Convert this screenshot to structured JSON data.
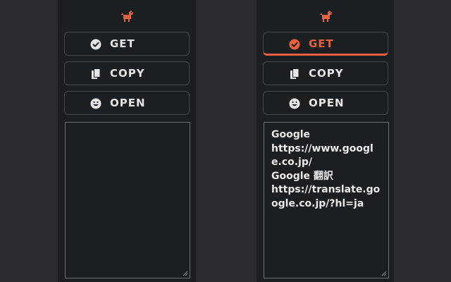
{
  "colors": {
    "accent": "#e9603e",
    "panel_bg": "#1c1f21",
    "page_bg": "#2b2c30",
    "text": "#e6e6e6",
    "border": "#43484c"
  },
  "left_panel": {
    "logo_icon": "dog-icon",
    "buttons": [
      {
        "label": "GET",
        "icon": "check-circle-icon",
        "active": false
      },
      {
        "label": "COPY",
        "icon": "copy-icon",
        "active": false
      },
      {
        "label": "OPEN",
        "icon": "smile-icon",
        "active": false
      }
    ],
    "textarea_value": ""
  },
  "right_panel": {
    "logo_icon": "dog-icon",
    "buttons": [
      {
        "label": "GET",
        "icon": "check-circle-icon",
        "active": true
      },
      {
        "label": "COPY",
        "icon": "copy-icon",
        "active": false
      },
      {
        "label": "OPEN",
        "icon": "smile-icon",
        "active": false
      }
    ],
    "textarea_lines": [
      "Google",
      "https://www.google.co.jp/",
      "Google 翻訳",
      "https://translate.google.co.jp/?hl=ja"
    ]
  }
}
